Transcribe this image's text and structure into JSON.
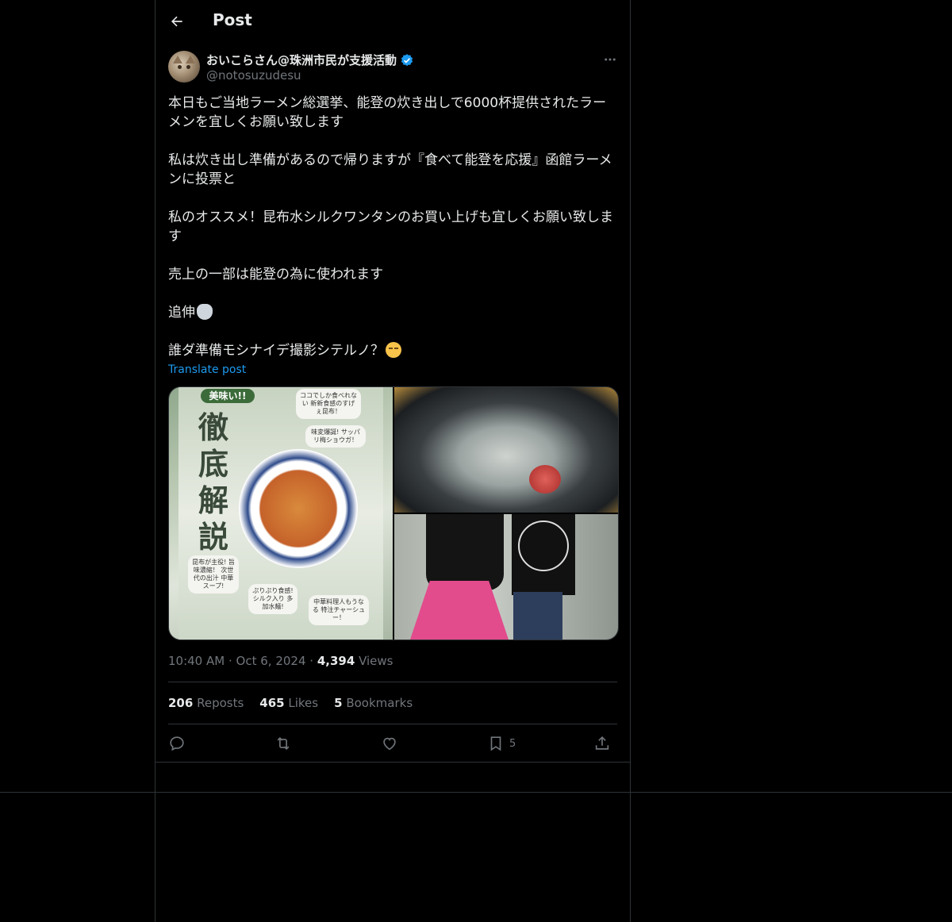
{
  "header": {
    "title": "Post"
  },
  "author": {
    "display_name": "おいこらさん@珠洲市民が支援活動",
    "handle": "@notosuzudesu",
    "verified": true
  },
  "post": {
    "paragraphs": [
      "本日もご当地ラーメン総選挙、能登の炊き出しで6000杯提供されたラーメンを宜しくお願い致します",
      "私は炊き出し準備があるので帰りますが『食べて能登を応援』函館ラーメンに投票と",
      "私のオススメ！昆布水シルクワンタンのお買い上げも宜しくお願い致します",
      "売上の一部は能登の為に使われます",
      "追伸",
      "誰ダ準備モシナイデ撮影シテルノ？"
    ],
    "translate_label": "Translate post"
  },
  "media": {
    "menu_kanji": "徹底解説",
    "menu_tagline": "美味い!!",
    "notes": [
      "ココでしか食べれない 新新食感のすげぇ昆布！",
      "味変爆誕! サッパリ梅ショウガ！",
      "昆布が主役! 旨味濃縮！ 次世代の出汁 中華スープ!",
      "ぷりぷり食感! シルク入り 多加水麺!",
      "中華料理人もうなる 特注チャーシュー！"
    ]
  },
  "meta": {
    "time": "10:40 AM",
    "date": "Oct 6, 2024",
    "views_count": "4,394",
    "views_label": "Views"
  },
  "stats": {
    "reposts_count": "206",
    "reposts_label": "Reposts",
    "likes_count": "465",
    "likes_label": "Likes",
    "bookmarks_count": "5",
    "bookmarks_label": "Bookmarks"
  },
  "actions": {
    "bookmark_count": "5"
  },
  "colors": {
    "accent": "#1d9bf0",
    "muted": "#71767b",
    "border": "#2f3336",
    "background": "#000000"
  }
}
